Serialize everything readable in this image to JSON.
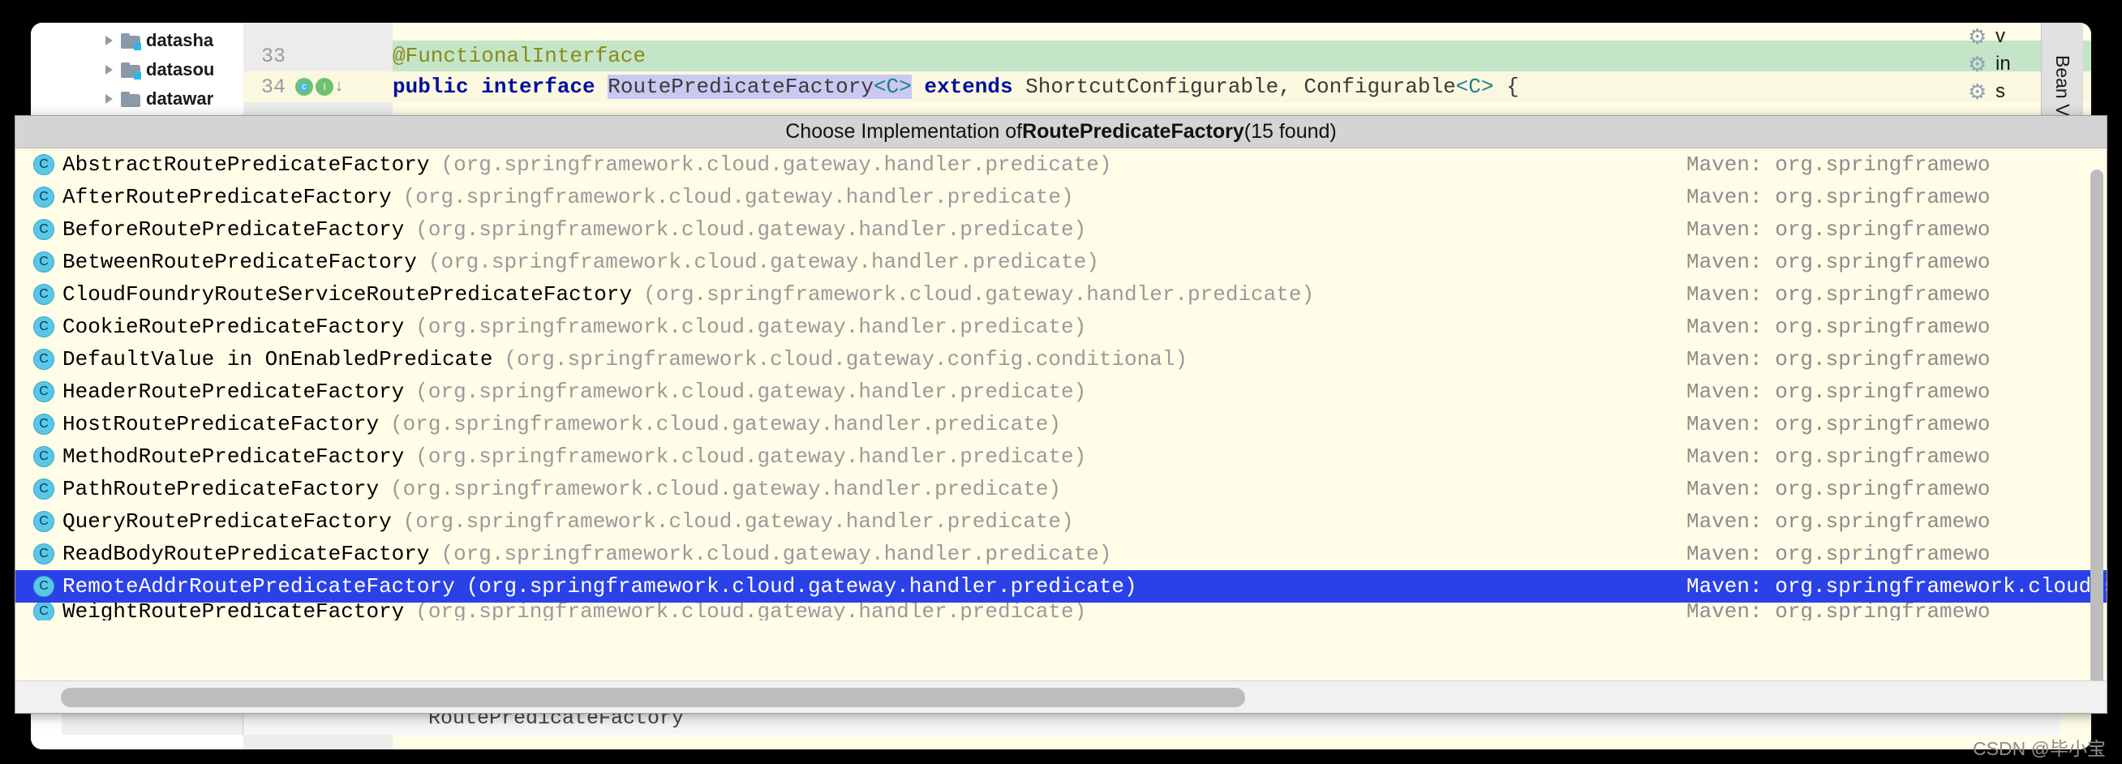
{
  "editor": {
    "project_tree": [
      {
        "label": "datasha",
        "icon": "folder-module-icon"
      },
      {
        "label": "datasou",
        "icon": "folder-module-icon"
      },
      {
        "label": "datawar",
        "icon": "folder-icon"
      }
    ],
    "lines": [
      {
        "number": "33",
        "annotation": "@FunctionalInterface",
        "bulb": "intention-bulb-icon"
      },
      {
        "number": "34",
        "kw1": "public",
        "kw2": "interface",
        "type_name": "RoutePredicateFactory",
        "generic1": "<C>",
        "kw3": "extends",
        "supers": " ShortcutConfigurable, Configurable",
        "generic2": "<C>",
        "brace": " {",
        "gutter_icons": [
          "class-implemented-icon",
          "interface-icon",
          "down-arrow-icon"
        ]
      }
    ],
    "right_gears": [
      {
        "icon": "gear-icon",
        "label": "v"
      },
      {
        "icon": "gear-icon",
        "label": "in"
      },
      {
        "icon": "gear-icon",
        "label": "s"
      }
    ],
    "right_tab": "Bean V",
    "bottom_code": "RoutePredicateFactory"
  },
  "popup": {
    "title_prefix": "Choose Implementation of ",
    "title_target": "RoutePredicateFactory",
    "title_suffix": " (15 found)",
    "maven_column_label": "Maven: ",
    "rows": [
      {
        "icon": "class-icon",
        "name": "AbstractRoutePredicateFactory",
        "pkg": "(org.springframework.cloud.gateway.handler.predicate)",
        "maven": "Maven: org.springframewo",
        "selected": false
      },
      {
        "icon": "class-icon",
        "name": "AfterRoutePredicateFactory",
        "pkg": "(org.springframework.cloud.gateway.handler.predicate)",
        "maven": "Maven: org.springframewo",
        "selected": false
      },
      {
        "icon": "class-icon",
        "name": "BeforeRoutePredicateFactory",
        "pkg": "(org.springframework.cloud.gateway.handler.predicate)",
        "maven": "Maven: org.springframewo",
        "selected": false
      },
      {
        "icon": "class-icon",
        "name": "BetweenRoutePredicateFactory",
        "pkg": "(org.springframework.cloud.gateway.handler.predicate)",
        "maven": "Maven: org.springframewo",
        "selected": false
      },
      {
        "icon": "class-icon",
        "name": "CloudFoundryRouteServiceRoutePredicateFactory",
        "pkg": "(org.springframework.cloud.gateway.handler.predicate)",
        "maven": "Maven: org.springframewo",
        "selected": false
      },
      {
        "icon": "class-icon",
        "name": "CookieRoutePredicateFactory",
        "pkg": "(org.springframework.cloud.gateway.handler.predicate)",
        "maven": "Maven: org.springframewo",
        "selected": false
      },
      {
        "icon": "class-icon",
        "name": "DefaultValue in OnEnabledPredicate",
        "pkg": "(org.springframework.cloud.gateway.config.conditional)",
        "maven": "Maven: org.springframewo",
        "selected": false
      },
      {
        "icon": "class-icon",
        "name": "HeaderRoutePredicateFactory",
        "pkg": "(org.springframework.cloud.gateway.handler.predicate)",
        "maven": "Maven: org.springframewo",
        "selected": false
      },
      {
        "icon": "class-icon",
        "name": "HostRoutePredicateFactory",
        "pkg": "(org.springframework.cloud.gateway.handler.predicate)",
        "maven": "Maven: org.springframewo",
        "selected": false
      },
      {
        "icon": "class-icon",
        "name": "MethodRoutePredicateFactory",
        "pkg": "(org.springframework.cloud.gateway.handler.predicate)",
        "maven": "Maven: org.springframewo",
        "selected": false
      },
      {
        "icon": "class-icon",
        "name": "PathRoutePredicateFactory",
        "pkg": "(org.springframework.cloud.gateway.handler.predicate)",
        "maven": "Maven: org.springframewo",
        "selected": false
      },
      {
        "icon": "class-icon",
        "name": "QueryRoutePredicateFactory",
        "pkg": "(org.springframework.cloud.gateway.handler.predicate)",
        "maven": "Maven: org.springframewo",
        "selected": false
      },
      {
        "icon": "class-icon",
        "name": "ReadBodyRoutePredicateFactory",
        "pkg": "(org.springframework.cloud.gateway.handler.predicate)",
        "maven": "Maven: org.springframewo",
        "selected": false
      },
      {
        "icon": "class-icon",
        "name": "RemoteAddrRoutePredicateFactory",
        "pkg": "(org.springframework.cloud.gateway.handler.predicate)",
        "maven": "Maven: org.springframework.cloud:sprin",
        "selected": true
      },
      {
        "icon": "class-icon",
        "name": "WeightRoutePredicateFactory",
        "pkg": "(org.springframework.cloud.gateway.handler.predicate)",
        "maven": "Maven: org.springframewo",
        "selected": false
      }
    ]
  },
  "watermark": "CSDN @毕小宝",
  "colors": {
    "popup_background": "#fffde7",
    "selection_blue": "#2a41e8",
    "title_bar": "#d4d4d4",
    "annotation_line": "#c5e5c9",
    "keyword": "#000f9e",
    "annotation_text": "#8a8a18"
  }
}
